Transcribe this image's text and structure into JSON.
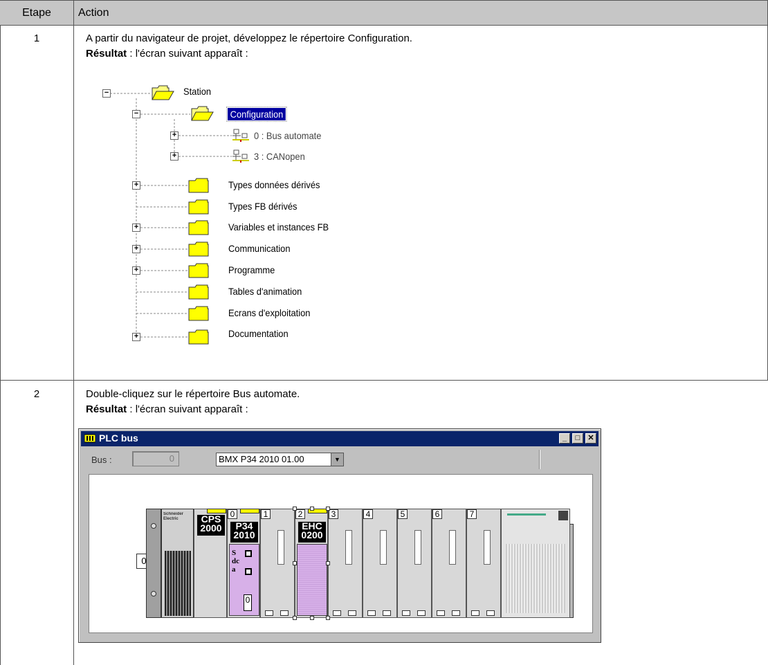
{
  "table": {
    "header": {
      "etape": "Etape",
      "action": "Action"
    },
    "steps": [
      {
        "number": "1",
        "instruction": "A partir du navigateur de projet, développez le répertoire Configuration.",
        "result_label": "Résultat",
        "result_text": " : l'écran suivant apparaît :"
      },
      {
        "number": "2",
        "instruction": "Double-cliquez sur le répertoire Bus automate.",
        "result_label": "Résultat",
        "result_text": " : l'écran suivant apparaît :"
      }
    ]
  },
  "project_tree": {
    "root": "Station",
    "configuration": "Configuration",
    "config_children": [
      "0 : Bus automate",
      "3 : CANopen"
    ],
    "folders": [
      "Types données dérivés",
      "Types FB dérivés",
      "Variables et instances FB",
      "Communication",
      "Programme",
      "Tables d'animation",
      "Ecrans d'exploitation",
      "Documentation"
    ],
    "expand_minus": "−",
    "expand_plus": "+"
  },
  "plc_window": {
    "title": "PLC bus",
    "bus_label": "Bus :",
    "bus_value": "0",
    "cpu_selection": "BMX P34 2010 01.00",
    "dropdown_arrow": "▼",
    "minimize": "_",
    "maximize": "□",
    "close": "✕",
    "rack_number": "0",
    "brand": "Schneider Electric",
    "slots": [
      "0",
      "1",
      "2",
      "3",
      "4",
      "5",
      "6",
      "7"
    ],
    "modules": {
      "ps": "CPS\n2000",
      "cpu": "P34\n2010",
      "cpu_side": "Sdca",
      "cpu_port": "0",
      "ehc": "EHC\n0200"
    },
    "colors": {
      "titlebar": "#0a246a",
      "module_label": "#ffff00",
      "module_body": "#d7b0e8"
    }
  }
}
